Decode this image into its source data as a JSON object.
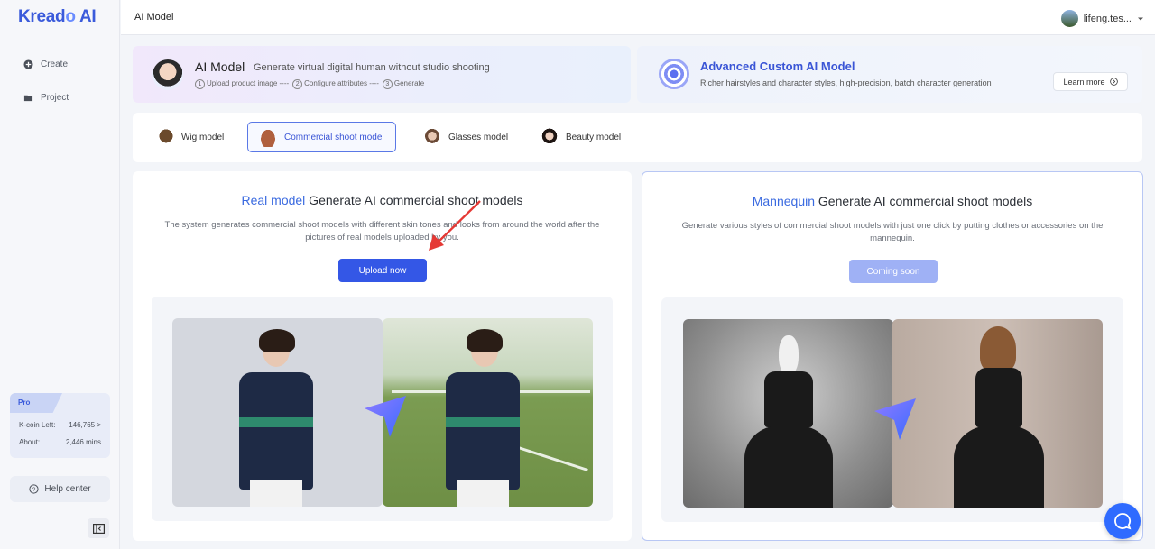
{
  "brand": {
    "name_main": "Kread",
    "name_o": "o",
    "name_rest": " AI"
  },
  "sidebar": {
    "items": [
      {
        "label": "Create"
      },
      {
        "label": "Project"
      }
    ],
    "pro": {
      "badge": "Pro",
      "kcoin_label": "K-coin Left:",
      "kcoin_value": "146,765 >",
      "about_label": "About:",
      "about_value": "2,446 mins"
    },
    "help_label": "Help center"
  },
  "topbar": {
    "title": "AI Model",
    "user_name": "lifeng.tes..."
  },
  "banner_left": {
    "title": "AI Model",
    "subtitle": "Generate virtual digital human without studio shooting",
    "steps": [
      {
        "num": "1",
        "label": "Upload product image ----"
      },
      {
        "num": "2",
        "label": "Configure attributes ----"
      },
      {
        "num": "3",
        "label": "Generate"
      }
    ]
  },
  "banner_right": {
    "title": "Advanced Custom AI Model",
    "subtitle": "Richer hairstyles and character styles, high-precision, batch character generation",
    "button": "Learn more"
  },
  "tabs": [
    {
      "label": "Wig model"
    },
    {
      "label": "Commercial shoot model"
    },
    {
      "label": "Glasses model"
    },
    {
      "label": "Beauty model"
    }
  ],
  "cards": {
    "left": {
      "title_accent": "Real model",
      "title_rest": " Generate AI commercial shoot models",
      "description": "The system generates commercial shoot models with different skin tones and looks from around the world after the pictures of real models uploaded by you.",
      "button": "Upload now"
    },
    "right": {
      "title_accent": "Mannequin",
      "title_rest": " Generate AI commercial shoot models",
      "description": "Generate various styles of commercial shoot models with just one click by putting clothes or accessories on the mannequin.",
      "button": "Coming soon"
    }
  },
  "colors": {
    "accent": "#3457e6",
    "accent_light": "#9fb1f5",
    "border_active": "#b8c7f4"
  }
}
